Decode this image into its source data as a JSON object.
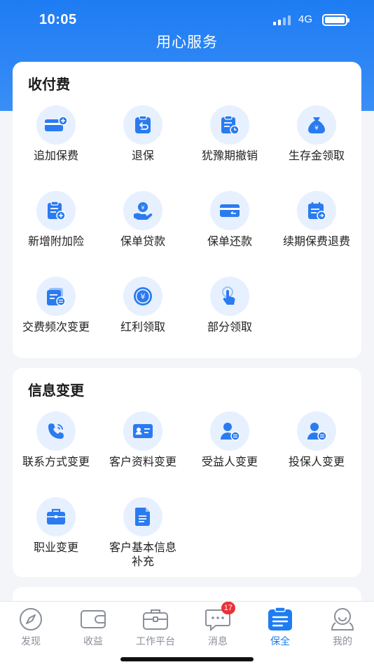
{
  "status_bar": {
    "time": "10:05",
    "network": "4G"
  },
  "nav": {
    "title": "用心服务"
  },
  "sections": [
    {
      "title": "收付费",
      "items": [
        {
          "label": "追加保费",
          "icon": "card-add-icon"
        },
        {
          "label": "退保",
          "icon": "return-icon"
        },
        {
          "label": "犹豫期撤销",
          "icon": "doc-clock-icon"
        },
        {
          "label": "生存金领取",
          "icon": "money-bag-icon"
        },
        {
          "label": "新增附加险",
          "icon": "doc-plus-icon"
        },
        {
          "label": "保单贷款",
          "icon": "hand-coin-icon"
        },
        {
          "label": "保单还款",
          "icon": "card-return-icon"
        },
        {
          "label": "续期保费退费",
          "icon": "calendar-icon"
        },
        {
          "label": "交费频次变更",
          "icon": "doc-switch-icon"
        },
        {
          "label": "红利领取",
          "icon": "coin-icon"
        },
        {
          "label": "部分领取",
          "icon": "tap-icon"
        }
      ]
    },
    {
      "title": "信息变更",
      "items": [
        {
          "label": "联系方式变更",
          "icon": "phone-icon"
        },
        {
          "label": "客户资料变更",
          "icon": "id-card-icon"
        },
        {
          "label": "受益人变更",
          "icon": "user-switch-icon"
        },
        {
          "label": "投保人变更",
          "icon": "user-switch-icon"
        },
        {
          "label": "职业变更",
          "icon": "briefcase-icon"
        },
        {
          "label": "客户基本信息补充",
          "icon": "document-icon"
        }
      ]
    }
  ],
  "tabbar": {
    "items": [
      {
        "label": "发现",
        "icon": "compass-icon",
        "active": false
      },
      {
        "label": "收益",
        "icon": "wallet-icon",
        "active": false
      },
      {
        "label": "工作平台",
        "icon": "briefcase-icon",
        "active": false
      },
      {
        "label": "消息",
        "icon": "chat-icon",
        "active": false,
        "badge": "17"
      },
      {
        "label": "保全",
        "icon": "clipboard-icon",
        "active": true
      },
      {
        "label": "我的",
        "icon": "person-icon",
        "active": false
      }
    ]
  },
  "colors": {
    "primary": "#1e7cf3",
    "icon_bg": "#e7f0fe",
    "badge": "#e8323a",
    "tab_inactive": "#8a8f99"
  }
}
